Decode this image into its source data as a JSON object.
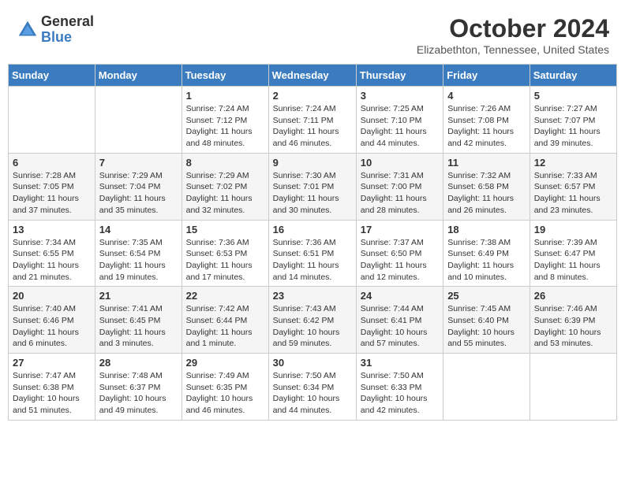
{
  "header": {
    "logo_general": "General",
    "logo_blue": "Blue",
    "month": "October 2024",
    "location": "Elizabethton, Tennessee, United States"
  },
  "days_of_week": [
    "Sunday",
    "Monday",
    "Tuesday",
    "Wednesday",
    "Thursday",
    "Friday",
    "Saturday"
  ],
  "weeks": [
    [
      {
        "day": "",
        "detail": ""
      },
      {
        "day": "",
        "detail": ""
      },
      {
        "day": "1",
        "detail": "Sunrise: 7:24 AM\nSunset: 7:12 PM\nDaylight: 11 hours and 48 minutes."
      },
      {
        "day": "2",
        "detail": "Sunrise: 7:24 AM\nSunset: 7:11 PM\nDaylight: 11 hours and 46 minutes."
      },
      {
        "day": "3",
        "detail": "Sunrise: 7:25 AM\nSunset: 7:10 PM\nDaylight: 11 hours and 44 minutes."
      },
      {
        "day": "4",
        "detail": "Sunrise: 7:26 AM\nSunset: 7:08 PM\nDaylight: 11 hours and 42 minutes."
      },
      {
        "day": "5",
        "detail": "Sunrise: 7:27 AM\nSunset: 7:07 PM\nDaylight: 11 hours and 39 minutes."
      }
    ],
    [
      {
        "day": "6",
        "detail": "Sunrise: 7:28 AM\nSunset: 7:05 PM\nDaylight: 11 hours and 37 minutes."
      },
      {
        "day": "7",
        "detail": "Sunrise: 7:29 AM\nSunset: 7:04 PM\nDaylight: 11 hours and 35 minutes."
      },
      {
        "day": "8",
        "detail": "Sunrise: 7:29 AM\nSunset: 7:02 PM\nDaylight: 11 hours and 32 minutes."
      },
      {
        "day": "9",
        "detail": "Sunrise: 7:30 AM\nSunset: 7:01 PM\nDaylight: 11 hours and 30 minutes."
      },
      {
        "day": "10",
        "detail": "Sunrise: 7:31 AM\nSunset: 7:00 PM\nDaylight: 11 hours and 28 minutes."
      },
      {
        "day": "11",
        "detail": "Sunrise: 7:32 AM\nSunset: 6:58 PM\nDaylight: 11 hours and 26 minutes."
      },
      {
        "day": "12",
        "detail": "Sunrise: 7:33 AM\nSunset: 6:57 PM\nDaylight: 11 hours and 23 minutes."
      }
    ],
    [
      {
        "day": "13",
        "detail": "Sunrise: 7:34 AM\nSunset: 6:55 PM\nDaylight: 11 hours and 21 minutes."
      },
      {
        "day": "14",
        "detail": "Sunrise: 7:35 AM\nSunset: 6:54 PM\nDaylight: 11 hours and 19 minutes."
      },
      {
        "day": "15",
        "detail": "Sunrise: 7:36 AM\nSunset: 6:53 PM\nDaylight: 11 hours and 17 minutes."
      },
      {
        "day": "16",
        "detail": "Sunrise: 7:36 AM\nSunset: 6:51 PM\nDaylight: 11 hours and 14 minutes."
      },
      {
        "day": "17",
        "detail": "Sunrise: 7:37 AM\nSunset: 6:50 PM\nDaylight: 11 hours and 12 minutes."
      },
      {
        "day": "18",
        "detail": "Sunrise: 7:38 AM\nSunset: 6:49 PM\nDaylight: 11 hours and 10 minutes."
      },
      {
        "day": "19",
        "detail": "Sunrise: 7:39 AM\nSunset: 6:47 PM\nDaylight: 11 hours and 8 minutes."
      }
    ],
    [
      {
        "day": "20",
        "detail": "Sunrise: 7:40 AM\nSunset: 6:46 PM\nDaylight: 11 hours and 6 minutes."
      },
      {
        "day": "21",
        "detail": "Sunrise: 7:41 AM\nSunset: 6:45 PM\nDaylight: 11 hours and 3 minutes."
      },
      {
        "day": "22",
        "detail": "Sunrise: 7:42 AM\nSunset: 6:44 PM\nDaylight: 11 hours and 1 minute."
      },
      {
        "day": "23",
        "detail": "Sunrise: 7:43 AM\nSunset: 6:42 PM\nDaylight: 10 hours and 59 minutes."
      },
      {
        "day": "24",
        "detail": "Sunrise: 7:44 AM\nSunset: 6:41 PM\nDaylight: 10 hours and 57 minutes."
      },
      {
        "day": "25",
        "detail": "Sunrise: 7:45 AM\nSunset: 6:40 PM\nDaylight: 10 hours and 55 minutes."
      },
      {
        "day": "26",
        "detail": "Sunrise: 7:46 AM\nSunset: 6:39 PM\nDaylight: 10 hours and 53 minutes."
      }
    ],
    [
      {
        "day": "27",
        "detail": "Sunrise: 7:47 AM\nSunset: 6:38 PM\nDaylight: 10 hours and 51 minutes."
      },
      {
        "day": "28",
        "detail": "Sunrise: 7:48 AM\nSunset: 6:37 PM\nDaylight: 10 hours and 49 minutes."
      },
      {
        "day": "29",
        "detail": "Sunrise: 7:49 AM\nSunset: 6:35 PM\nDaylight: 10 hours and 46 minutes."
      },
      {
        "day": "30",
        "detail": "Sunrise: 7:50 AM\nSunset: 6:34 PM\nDaylight: 10 hours and 44 minutes."
      },
      {
        "day": "31",
        "detail": "Sunrise: 7:50 AM\nSunset: 6:33 PM\nDaylight: 10 hours and 42 minutes."
      },
      {
        "day": "",
        "detail": ""
      },
      {
        "day": "",
        "detail": ""
      }
    ]
  ]
}
